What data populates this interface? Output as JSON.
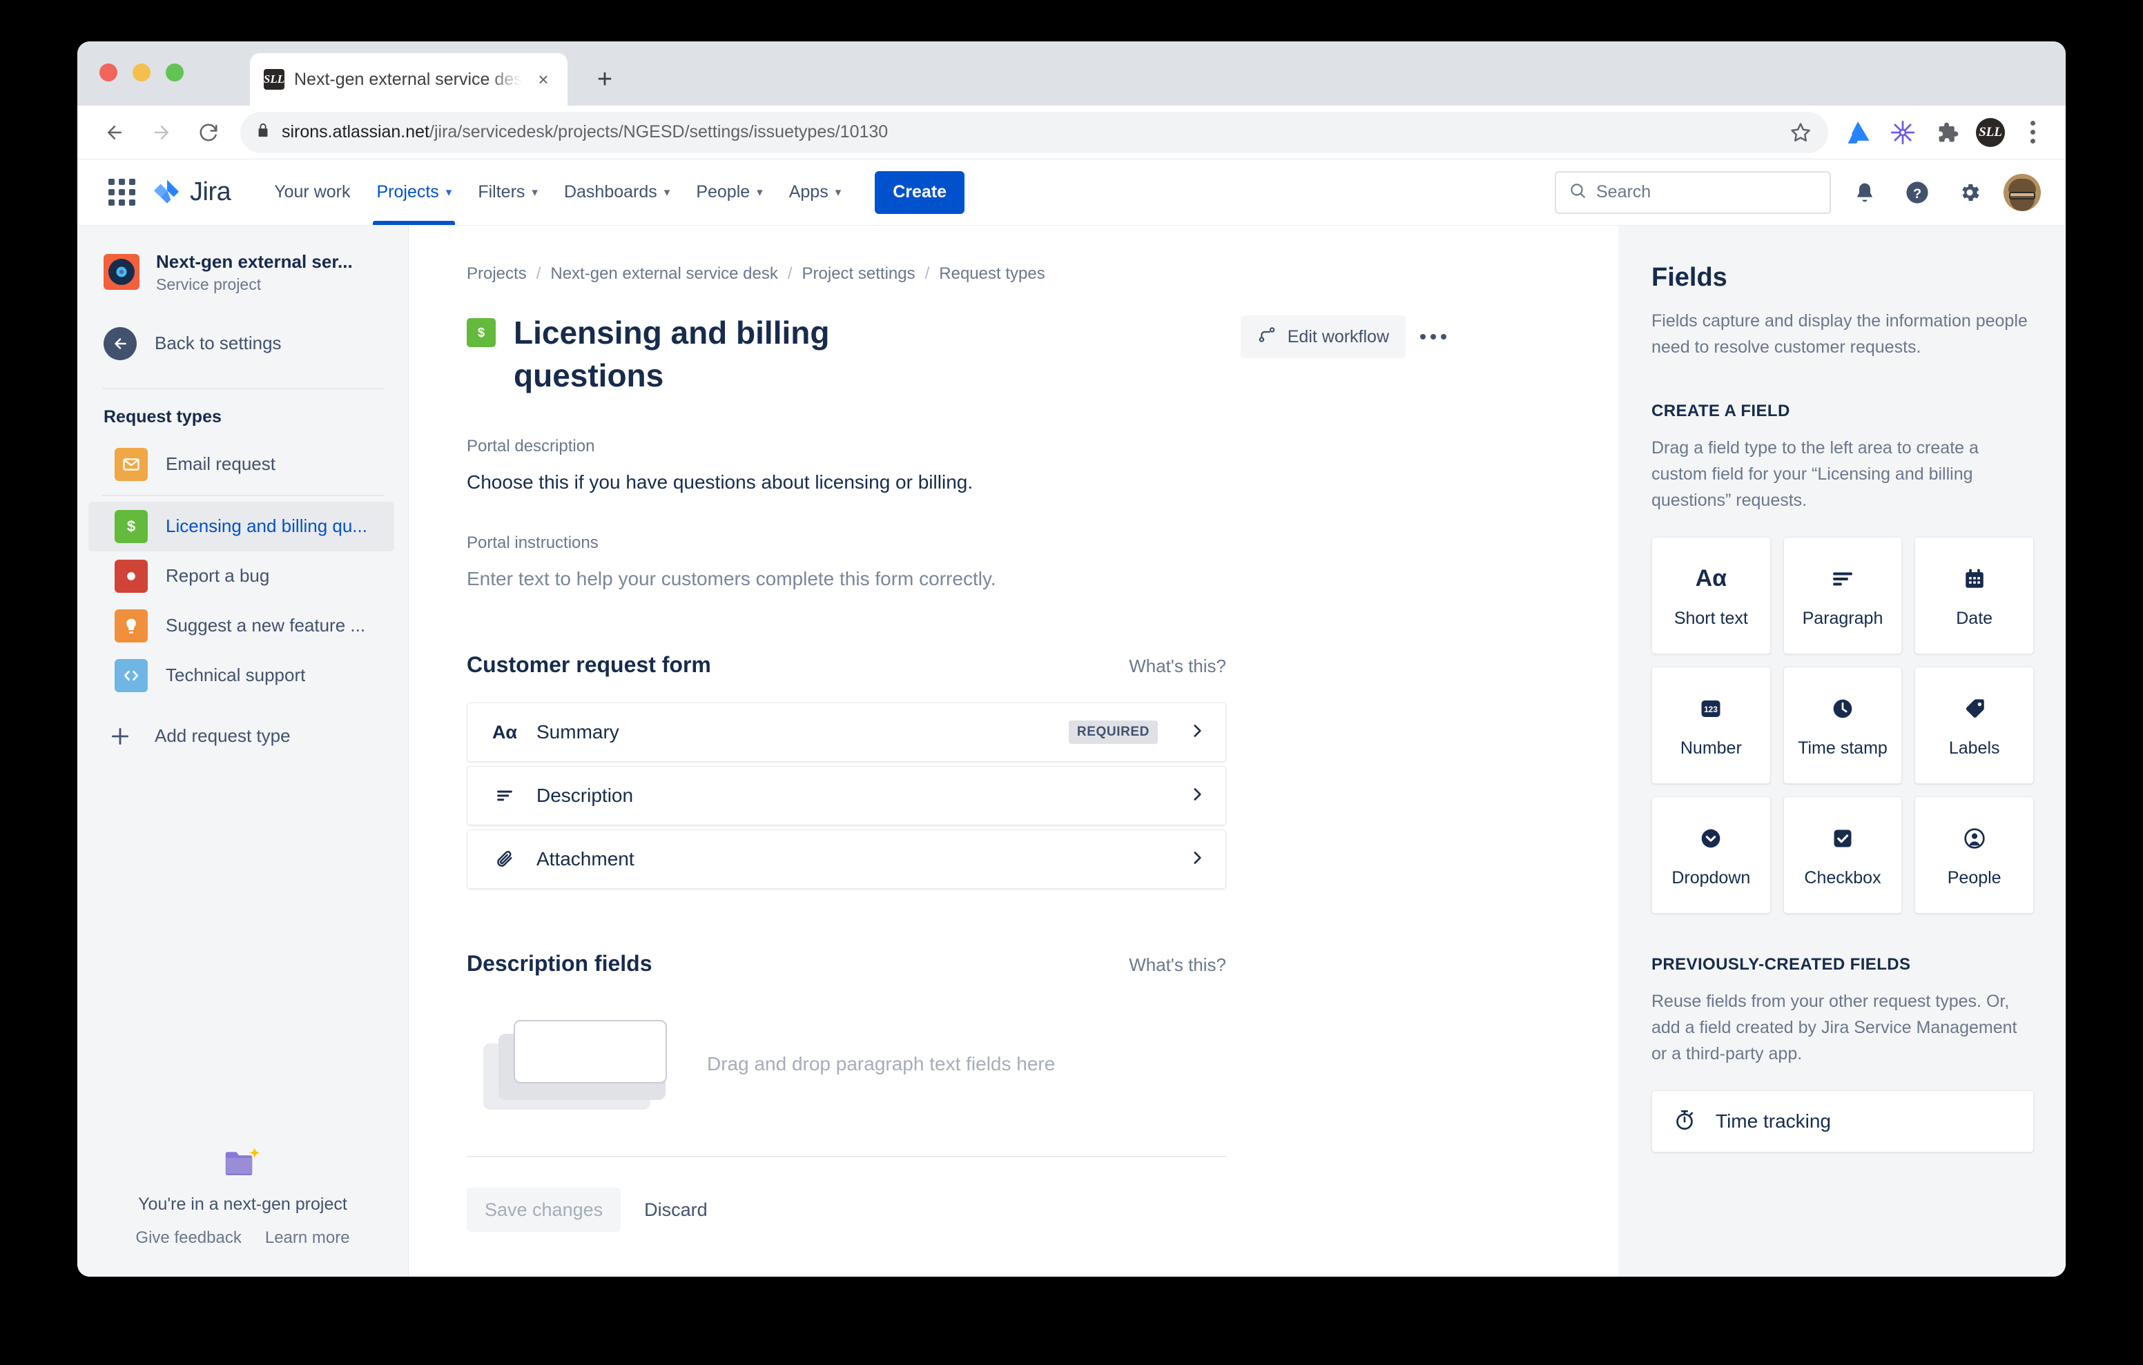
{
  "browser": {
    "tab": {
      "title": "Next-gen external service desk",
      "favicon_text": "SLL",
      "close_icon": "×"
    },
    "new_tab_label": "+",
    "url": {
      "domain": "sirons.atlassian.net",
      "path": "/jira/servicedesk/projects/NGESD/settings/issuetypes/10130"
    }
  },
  "topnav": {
    "brand": "Jira",
    "items": [
      {
        "label": "Your work",
        "has_caret": false,
        "active": false
      },
      {
        "label": "Projects",
        "has_caret": true,
        "active": true
      },
      {
        "label": "Filters",
        "has_caret": true,
        "active": false
      },
      {
        "label": "Dashboards",
        "has_caret": true,
        "active": false
      },
      {
        "label": "People",
        "has_caret": true,
        "active": false
      },
      {
        "label": "Apps",
        "has_caret": true,
        "active": false
      }
    ],
    "create_label": "Create",
    "search_placeholder": "Search",
    "accent_color": "#0052cc"
  },
  "sidebar": {
    "project_name": "Next-gen external ser...",
    "project_type": "Service project",
    "back_label": "Back to settings",
    "section_title": "Request types",
    "items": [
      {
        "label": "Email request",
        "icon": "email-icon",
        "selected": false
      },
      {
        "label": "Licensing and billing qu...",
        "icon": "money-icon",
        "selected": true
      },
      {
        "label": "Report a bug",
        "icon": "bug-icon",
        "selected": false
      },
      {
        "label": "Suggest a new feature ...",
        "icon": "lightbulb-icon",
        "selected": false
      },
      {
        "label": "Technical support",
        "icon": "code-icon",
        "selected": false
      }
    ],
    "add_label": "Add request type",
    "footer_text": "You're in a next-gen project",
    "footer_links": [
      "Give feedback",
      "Learn more"
    ]
  },
  "main": {
    "breadcrumb": [
      "Projects",
      "Next-gen external service desk",
      "Project settings",
      "Request types"
    ],
    "title": "Licensing and billing questions",
    "edit_workflow_label": "Edit workflow",
    "portal_description_label": "Portal description",
    "portal_description_value": "Choose this if you have questions about licensing or billing.",
    "portal_instructions_label": "Portal instructions",
    "portal_instructions_placeholder": "Enter text to help your customers complete this form correctly.",
    "request_form": {
      "title": "Customer request form",
      "whats_this": "What's this?",
      "rows": [
        {
          "label": "Summary",
          "icon": "short-text-icon",
          "badge": "REQUIRED"
        },
        {
          "label": "Description",
          "icon": "paragraph-icon",
          "badge": ""
        },
        {
          "label": "Attachment",
          "icon": "paperclip-icon",
          "badge": ""
        }
      ]
    },
    "description_fields": {
      "title": "Description fields",
      "whats_this": "What's this?",
      "dropzone_text": "Drag and drop paragraph text fields here"
    },
    "save_label": "Save changes",
    "discard_label": "Discard"
  },
  "rightpanel": {
    "title": "Fields",
    "description": "Fields capture and display the information people need to resolve customer requests.",
    "create_heading": "CREATE A FIELD",
    "create_description": "Drag a field type to the left area to create a custom field for your “Licensing and billing questions” requests.",
    "field_types": [
      {
        "label": "Short text",
        "icon": "short-text-icon"
      },
      {
        "label": "Paragraph",
        "icon": "paragraph-icon"
      },
      {
        "label": "Date",
        "icon": "calendar-icon"
      },
      {
        "label": "Number",
        "icon": "number-icon"
      },
      {
        "label": "Time stamp",
        "icon": "clock-icon"
      },
      {
        "label": "Labels",
        "icon": "tag-icon"
      },
      {
        "label": "Dropdown",
        "icon": "chevron-down-circle-icon"
      },
      {
        "label": "Checkbox",
        "icon": "checkbox-icon"
      },
      {
        "label": "People",
        "icon": "person-icon"
      }
    ],
    "previous_heading": "PREVIOUSLY-CREATED FIELDS",
    "previous_description": "Reuse fields from your other request types. Or, add a field created by Jira Service Management or a third-party app.",
    "previous_fields": [
      {
        "label": "Time tracking",
        "icon": "stopwatch-icon"
      }
    ]
  }
}
